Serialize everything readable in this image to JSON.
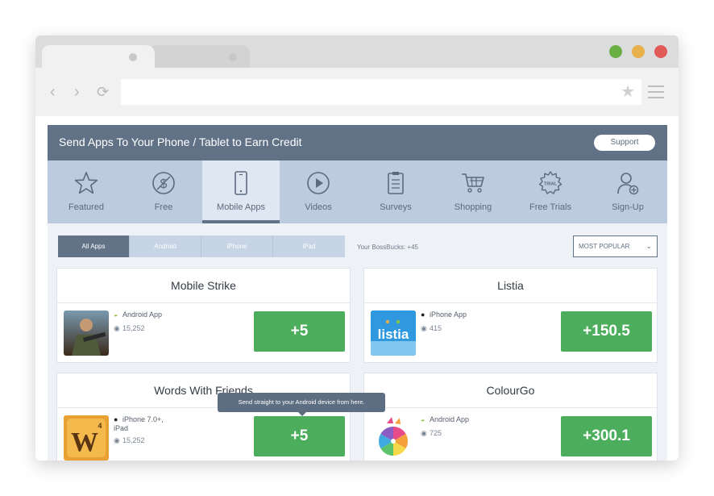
{
  "colors": {
    "banner": "#617287",
    "nav_bg": "#bccbe0",
    "nav_active": "#dfe7f3",
    "credit_green": "#4cae5c",
    "light_green": "#6ab045",
    "light_yellow": "#e8b04a",
    "light_red": "#e05a57"
  },
  "browser": {
    "back_icon": "chevron-left-icon",
    "forward_icon": "chevron-right-icon",
    "reload_icon": "reload-icon",
    "bookmark_icon": "star-icon",
    "menu_icon": "hamburger-icon"
  },
  "banner": {
    "title": "Send Apps To Your Phone / Tablet to Earn Credit",
    "support_label": "Support"
  },
  "nav": [
    {
      "label": "Featured",
      "icon": "star-icon"
    },
    {
      "label": "Free",
      "icon": "dollar-circle-icon"
    },
    {
      "label": "Mobile Apps",
      "icon": "smartphone-icon",
      "active": true
    },
    {
      "label": "Videos",
      "icon": "play-circle-icon"
    },
    {
      "label": "Surveys",
      "icon": "clipboard-icon"
    },
    {
      "label": "Shopping",
      "icon": "cart-icon"
    },
    {
      "label": "Free Trials",
      "icon": "trial-badge-icon",
      "badge_text": "TRIAL"
    },
    {
      "label": "Sign-Up",
      "icon": "user-add-icon"
    }
  ],
  "filters": {
    "tabs": [
      "All Apps",
      "Android",
      "iPhone",
      "iPad"
    ],
    "active_tab": "All Apps",
    "bossbucks": "Your BossBucks: +45",
    "sort_selected": "MOST POPULAR"
  },
  "apps": [
    {
      "title": "Mobile Strike",
      "platform": "Android App",
      "platform_icon": "android-icon",
      "users": "15,252",
      "credit": "+5"
    },
    {
      "title": "Listia",
      "platform": "iPhone App",
      "platform_icon": "apple-icon",
      "users": "415",
      "credit": "+150.5",
      "thumb_text": "listia"
    },
    {
      "title": "Words With Friends",
      "platform": "iPhone 7.0+, iPad",
      "platform_icon": "apple-icon",
      "users": "15,252",
      "credit": "+5",
      "thumb_text": "W",
      "thumb_sub": "4"
    },
    {
      "title": "ColourGo",
      "platform": "Android App",
      "platform_icon": "android-icon",
      "users": "725",
      "credit": "+300.1"
    }
  ],
  "tooltip": {
    "text": "Send straight to your Android device from here."
  }
}
